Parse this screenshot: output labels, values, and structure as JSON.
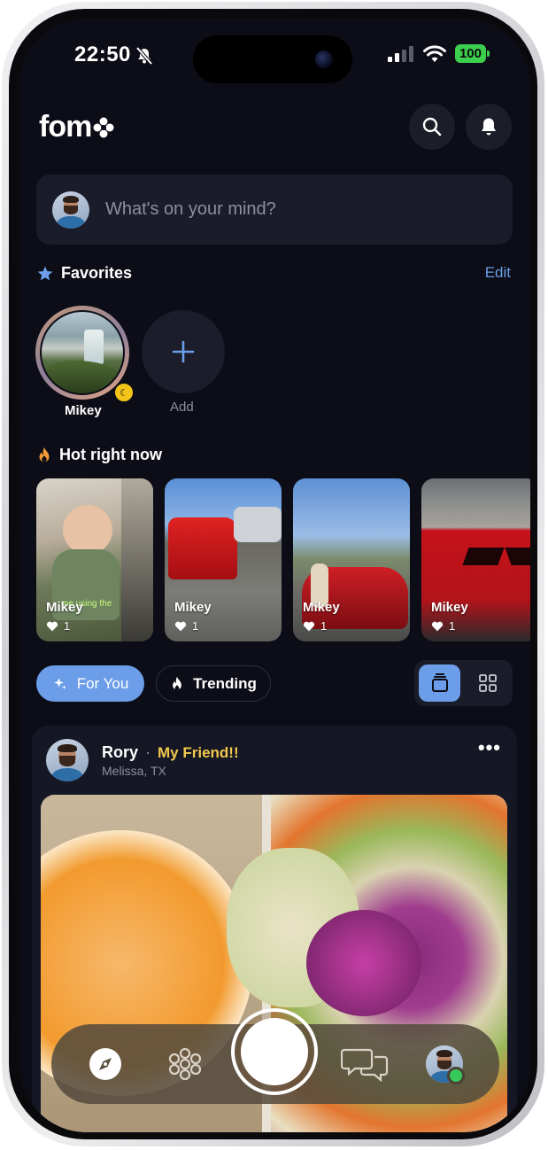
{
  "status": {
    "time": "22:50",
    "battery": "100"
  },
  "app": {
    "logo_text": "fom"
  },
  "composer": {
    "placeholder": "What's on your mind?"
  },
  "favorites": {
    "title": "Favorites",
    "edit_label": "Edit",
    "items": [
      {
        "name": "Mikey"
      }
    ],
    "add_label": "Add"
  },
  "hot": {
    "title": "Hot right now",
    "cards": [
      {
        "name": "Mikey",
        "likes": "1",
        "caption": "me using the"
      },
      {
        "name": "Mikey",
        "likes": "1"
      },
      {
        "name": "Mikey",
        "likes": "1"
      },
      {
        "name": "Mikey",
        "likes": "1"
      }
    ]
  },
  "feed_filters": {
    "for_you": "For You",
    "trending": "Trending"
  },
  "post": {
    "author": "Rory",
    "separator": "·",
    "tag": "My Friend!!",
    "location": "Melissa, TX",
    "more": "•••"
  },
  "colors": {
    "accent": "#6b9de8",
    "background": "#0c0d16",
    "tag": "#f2c94c",
    "online": "#38c95b"
  },
  "icons": [
    "search-icon",
    "bell-icon",
    "star-icon",
    "moon-icon",
    "plus-icon",
    "fire-icon",
    "sparkle-icon",
    "heart-icon",
    "stack-view-icon",
    "grid-view-icon",
    "more-icon",
    "compass-icon",
    "flower-icon",
    "camera-shutter",
    "chat-icon",
    "profile-avatar"
  ]
}
